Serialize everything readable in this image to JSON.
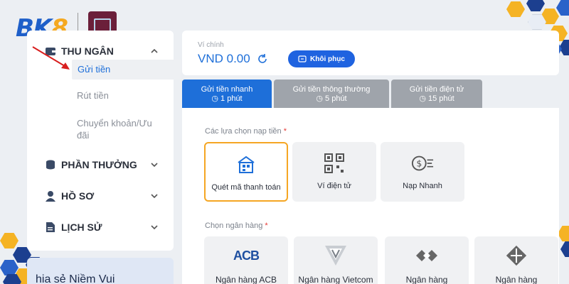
{
  "brand": {
    "logo_main": "BK",
    "logo_accent": "8"
  },
  "sidebar": {
    "sections": [
      {
        "label": "THU NGÂN",
        "icon": "wallet-icon"
      },
      {
        "label": "PHẦN THƯỞNG",
        "icon": "coins-icon"
      },
      {
        "label": "HỒ SƠ",
        "icon": "user-icon"
      },
      {
        "label": "LỊCH SỬ",
        "icon": "document-icon"
      }
    ],
    "sub_items": [
      "Gửi tiền",
      "Rút tiền",
      "Chuyển khoản/Ưu đãi"
    ],
    "share_text": "hia sẻ Niềm Vui"
  },
  "wallet": {
    "label": "Ví chính",
    "amount": "VND 0.00",
    "restore_label": "Khôi phục"
  },
  "tabs": [
    {
      "label": "Gửi tiền nhanh",
      "time": "1 phút",
      "active": true
    },
    {
      "label": "Gửi tiền thông thường",
      "time": "5 phút",
      "active": false
    },
    {
      "label": "Gửi tiền điện tử",
      "time": "15 phút",
      "active": false
    }
  ],
  "deposit_options": {
    "title": "Các lựa chọn nạp tiền",
    "required_mark": "*",
    "items": [
      {
        "label": "Quét mã thanh toán",
        "icon": "qr-scan-icon",
        "selected": true
      },
      {
        "label": "Ví điện tử",
        "icon": "qr-code-icon",
        "selected": false
      },
      {
        "label": "Nạp Nhanh",
        "icon": "fast-coin-icon",
        "selected": false
      }
    ]
  },
  "banks": {
    "title": "Chọn ngân hàng",
    "required_mark": "*",
    "items": [
      {
        "label": "Ngân hàng ACB",
        "logo": "ACB"
      },
      {
        "label": "Ngân hàng Vietcom",
        "logo": "vietcombank-icon"
      },
      {
        "label": "Ngân hàng",
        "logo": "techcombank-icon"
      },
      {
        "label": "Ngân hàng",
        "logo": "bank-diamond-icon"
      }
    ]
  },
  "colors": {
    "primary": "#1e6fd9",
    "accent": "#f5a623",
    "required": "#e53935",
    "tab_inactive": "#9fa4ab"
  }
}
